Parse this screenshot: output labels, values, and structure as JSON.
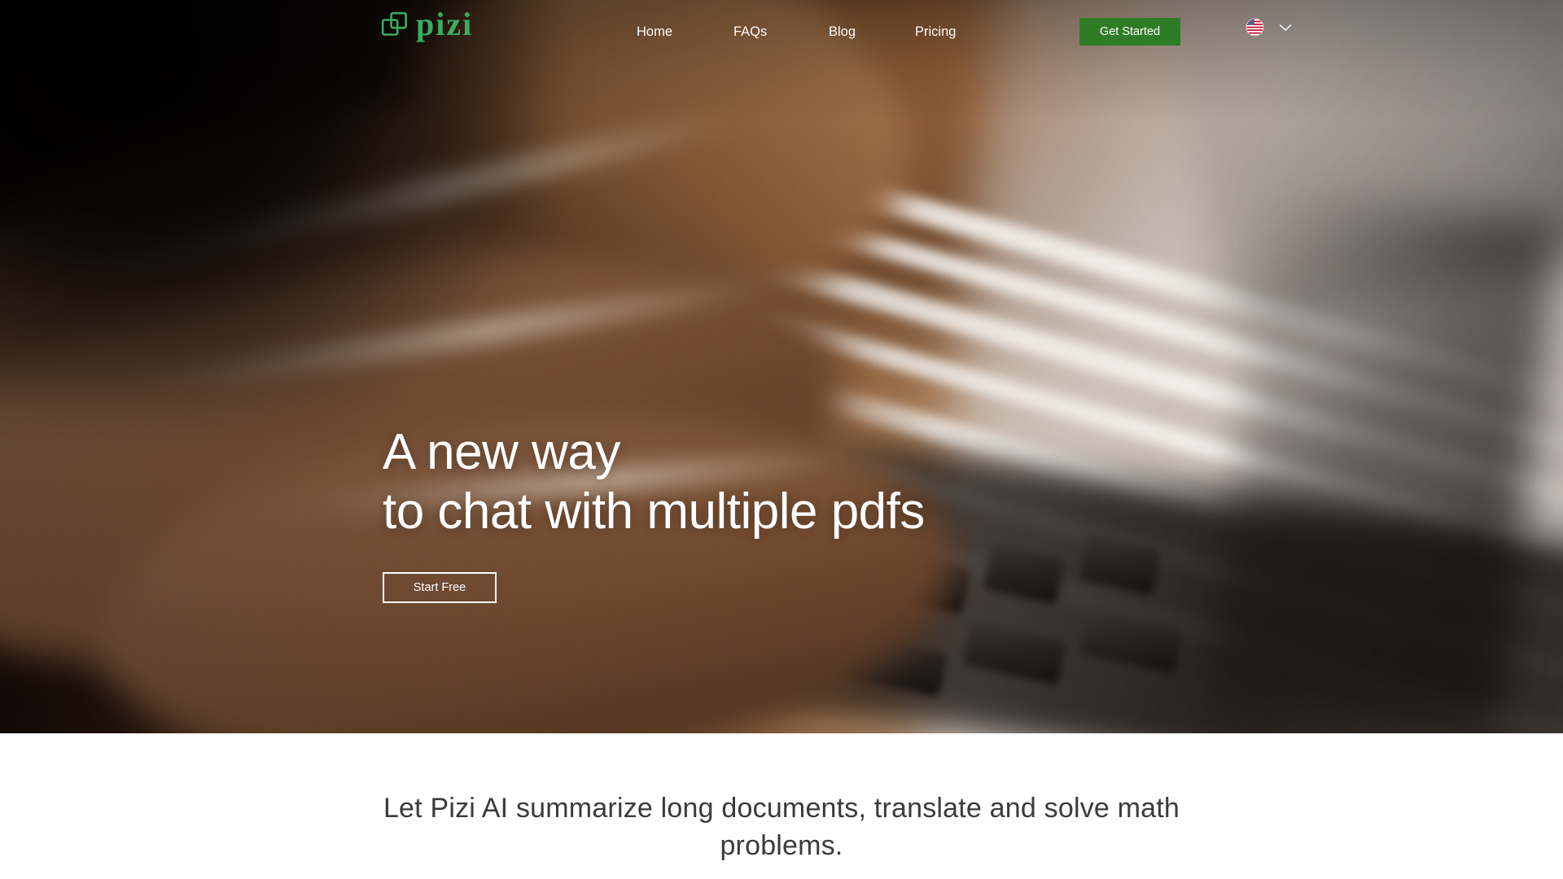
{
  "site": {
    "logo_text": "pizi",
    "logo_icon": "layers-squares-icon",
    "brand_green": "#3aab63",
    "accent_green": "#2e7d26"
  },
  "header": {
    "nav": [
      {
        "label": "Home"
      },
      {
        "label": "FAQs"
      },
      {
        "label": "Blog"
      },
      {
        "label": "Pricing"
      }
    ],
    "cta_label": "Get Started",
    "language": {
      "flag_icon": "us-flag-icon",
      "chevron_icon": "chevron-down-icon"
    }
  },
  "hero": {
    "headline_line1": "A new way",
    "headline_line2": "to chat with multiple pdfs",
    "cta_label": "Start Free"
  },
  "below": {
    "subtitle": "Let Pizi AI summarize long documents, translate and solve math problems."
  }
}
